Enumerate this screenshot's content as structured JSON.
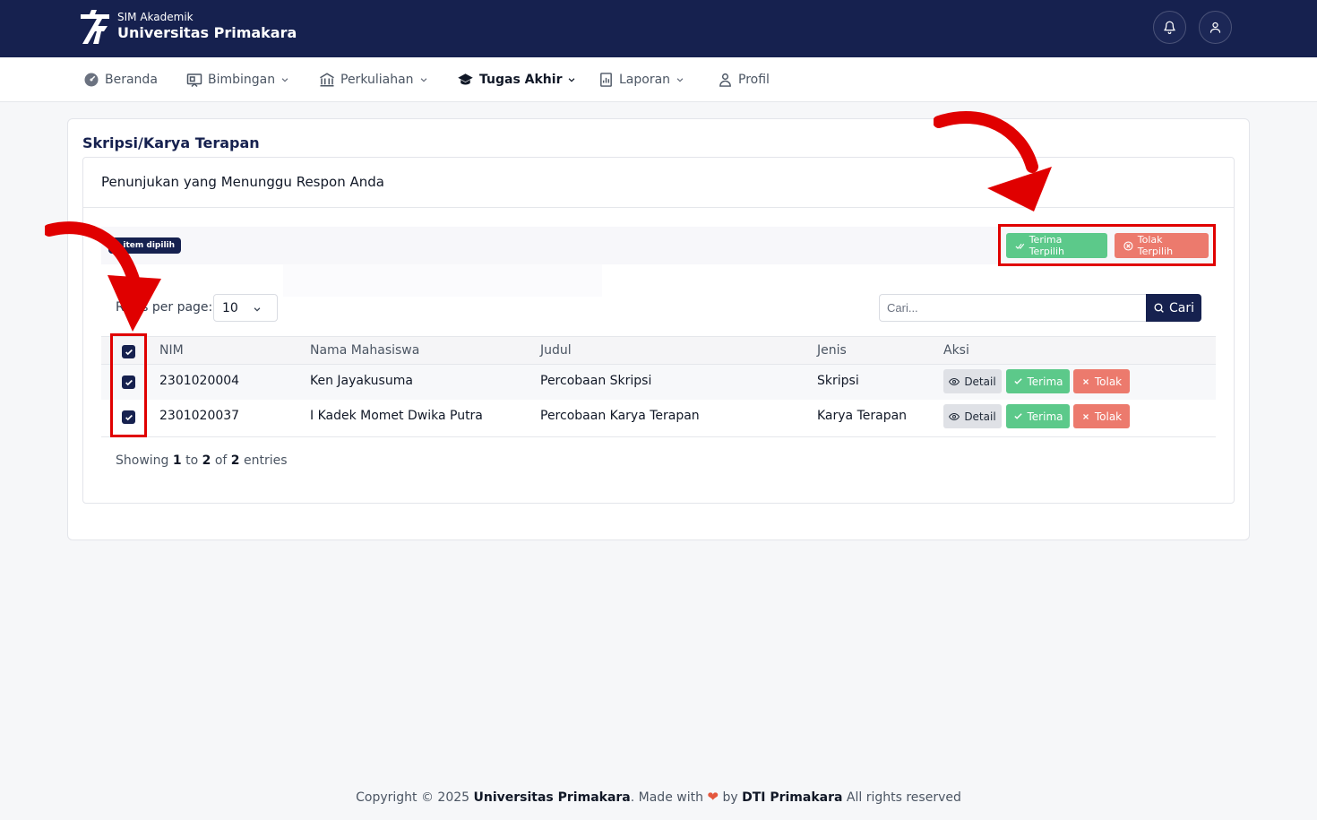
{
  "header": {
    "app_subtitle": "SIM Akademik",
    "app_title": "Universitas Primakara"
  },
  "nav": {
    "items": [
      {
        "label": "Beranda"
      },
      {
        "label": "Bimbingan"
      },
      {
        "label": "Perkuliahan"
      },
      {
        "label": "Tugas Akhir"
      },
      {
        "label": "Laporan"
      },
      {
        "label": "Profil"
      }
    ]
  },
  "page": {
    "title": "Skripsi/Karya Terapan",
    "card_title": "Penunjukan yang Menunggu Respon Anda",
    "selected_badge": "2 item dipilih",
    "bulk_accept_label": "Terima Terpilih",
    "bulk_reject_label": "Tolak Terpilih",
    "rows_per_page_label": "Rows per page:",
    "rows_per_page_value": "10",
    "search_placeholder": "Cari...",
    "search_button": "Cari"
  },
  "table": {
    "columns": [
      "NIM",
      "Nama Mahasiswa",
      "Judul",
      "Jenis",
      "Aksi"
    ],
    "rows": [
      {
        "nim": "2301020004",
        "nama": "Ken Jayakusuma",
        "judul": "Percobaan Skripsi",
        "jenis": "Skripsi",
        "detail": "Detail",
        "terima": "Terima",
        "tolak": "Tolak"
      },
      {
        "nim": "2301020037",
        "nama": "I Kadek Momet Dwika Putra",
        "judul": "Percobaan Karya Terapan",
        "jenis": "Karya Terapan",
        "detail": "Detail",
        "terima": "Terima",
        "tolak": "Tolak"
      }
    ],
    "showing": {
      "prefix": "Showing",
      "from": "1",
      "to_word": "to",
      "to": "2",
      "of_word": "of",
      "total": "2",
      "suffix": "entries"
    }
  },
  "footer": {
    "copyright": "Copyright © 2025",
    "org": "Universitas Primakara",
    "made_with": ". Made with",
    "by": "by",
    "team": "DTI Primakara",
    "rights": "All rights reserved"
  },
  "colors": {
    "primary": "#16214f",
    "accept": "#5cc98a",
    "reject": "#ec7a6d",
    "annotation": "#e00000"
  }
}
